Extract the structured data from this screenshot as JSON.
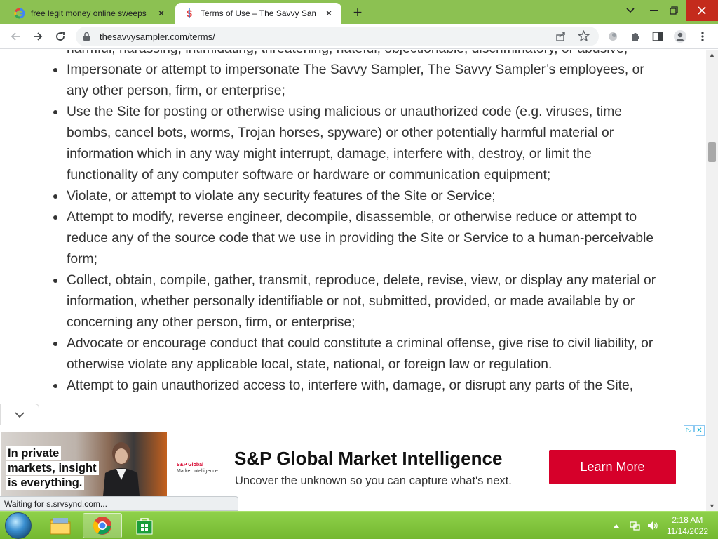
{
  "browser": {
    "tabs": [
      {
        "title": "free legit money online sweeps g",
        "favicon": "google-icon",
        "active": false
      },
      {
        "title": "Terms of Use – The Savvy Sampler",
        "favicon": "savvy-sampler-icon",
        "active": true
      }
    ],
    "address_bar": {
      "url": "thesavvysampler.com/terms/"
    }
  },
  "page": {
    "items": [
      "harmful, harassing, intimidating, threatening, hateful, objectionable, discriminatory, or abusive;",
      "Impersonate or attempt to impersonate The Savvy Sampler, The Savvy Sampler’s employees, or any other person, firm, or enterprise;",
      "Use the Site for posting or otherwise using malicious or unauthorized code (e.g. viruses, time bombs, cancel bots, worms, Trojan horses, spyware) or other potentially harmful material or information which in any way might interrupt, damage, interfere with, destroy, or limit the functionality of any computer software or hardware or communication equipment;",
      "Violate, or attempt to violate any security features of the Site or Service;",
      "Attempt to modify, reverse engineer, decompile, disassemble, or otherwise reduce or attempt to reduce any of the source code that we use in providing the Site or Service to a human-perceivable form;",
      "Collect, obtain, compile, gather, transmit, reproduce, delete, revise, view, or display any material or information, whether personally identifiable or not, submitted, provided, or made available by or concerning any other person, firm, or enterprise;",
      "Advocate or encourage conduct that could constitute a criminal offense, give rise to civil liability, or otherwise violate any applicable local, state, national, or foreign law or regulation.",
      "Attempt to gain unauthorized access to, interfere with, damage, or disrupt any parts of the Site,"
    ]
  },
  "ad": {
    "slogan_lines": [
      "In private",
      "markets, insight",
      "is everything."
    ],
    "logo_name": "S&P Global",
    "logo_sub": "Market Intelligence",
    "headline": "S&P Global Market Intelligence",
    "subtext": "Uncover the unknown so you can capture what's next.",
    "cta": "Learn More",
    "cta_color": "#d6002a"
  },
  "status_bar": {
    "text": "Waiting for s.srvsynd.com..."
  },
  "taskbar": {
    "time": "2:18 AM",
    "date": "11/14/2022",
    "color": "#7cc23a"
  }
}
